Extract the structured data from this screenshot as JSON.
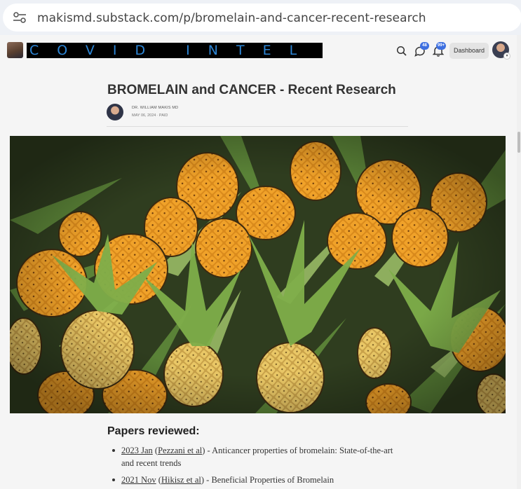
{
  "browser": {
    "url": "makismd.substack.com/p/bromelain-and-cancer-recent-research"
  },
  "header": {
    "banner_text": "COVID INTEL",
    "chat_badge": "48",
    "notif_badge": "99+",
    "dashboard_label": "Dashboard",
    "banner_text_color": "#2d86d6",
    "badge_color": "#3d6fe0"
  },
  "article": {
    "title": "BROMELAIN and CANCER - Recent Research",
    "author": "DR. WILLIAM MAKIS MD",
    "date_line": "MAY 06, 2024 ∙ PAID",
    "section_heading": "Papers reviewed:",
    "papers": [
      {
        "year_link": "2023 Jan",
        "author_link": "Pezzani et al",
        "text": "Anticancer properties of bromelain: State-of-the-art and recent trends"
      },
      {
        "year_link": "2021 Nov",
        "author_link": "Hikisz et al",
        "text": "Beneficial Properties of Bromelain"
      }
    ]
  },
  "icons": [
    "tune-icon",
    "search-icon",
    "chat-icon",
    "bell-icon",
    "chevron-down-icon"
  ]
}
